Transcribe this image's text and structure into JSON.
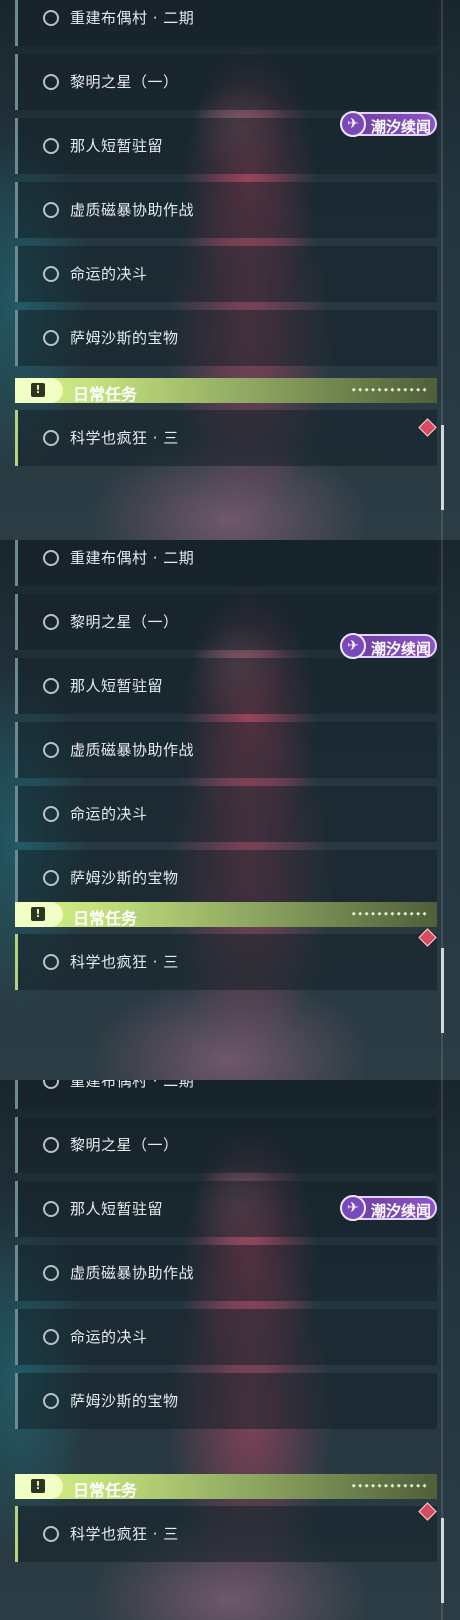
{
  "quests": [
    {
      "label": "重建布偶村 · 二期"
    },
    {
      "label": "黎明之星（一）"
    },
    {
      "label": "那人短暂驻留"
    },
    {
      "label": "虚质磁暴协助作战"
    },
    {
      "label": "命运的决斗"
    },
    {
      "label": "萨姆沙斯的宝物"
    }
  ],
  "daily": {
    "header": "日常任务",
    "header_icon": "!",
    "header_small_text": "◆ ◆ ◆ ◆ ◆ ◆ ◆ ◆ ◆ ◆ ◆ ◆",
    "item": {
      "label": "科学也疯狂 · 三"
    }
  },
  "tag": {
    "label": "潮汐续闻",
    "icon": "swirl-icon",
    "icon_glyph": "✈"
  },
  "colors": {
    "accent_green": "#c3e07c",
    "tag_purple": "#8b55c8",
    "marker_red": "#d44c5f"
  }
}
